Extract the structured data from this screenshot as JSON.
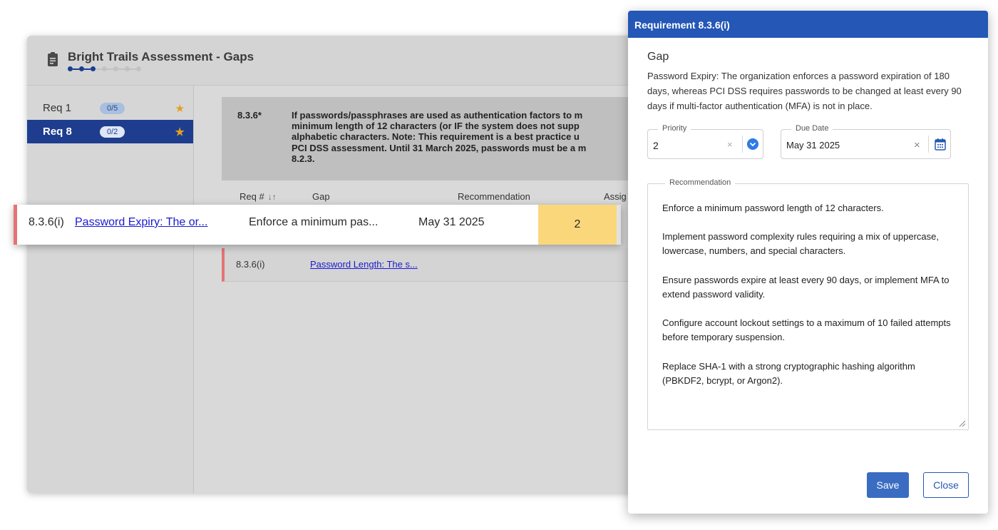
{
  "app": {
    "title": "Bright Trails Assessment - Gaps",
    "progress": {
      "completed_steps": 3,
      "total_steps": 7
    }
  },
  "sidebar": {
    "items": [
      {
        "label": "Req 1",
        "badge": "0/5",
        "active": false,
        "icon": "star-icon"
      },
      {
        "label": "Req 8",
        "badge": "0/2",
        "active": true,
        "icon": "star-icon"
      }
    ]
  },
  "requirement": {
    "code": "8.3.6*",
    "text": "If passwords/passphrases are used as authentication factors to m\nminimum length of 12 characters (or IF the system does not supp\nalphabetic characters.  Note: This requirement is a best practice u\nPCI DSS assessment. Until  31 March 2025, passwords must be a m\n8.2.3."
  },
  "table": {
    "headers": {
      "req": "Req #",
      "gap": "Gap",
      "recommendation": "Recommendation",
      "assignee": "Assig"
    },
    "sort_icon": "↓↑",
    "rows": [
      {
        "req": "8.3.6(i)",
        "gap": "Password Expiry: The or...",
        "recommendation": "Enforce a minimum pas...",
        "due": "May 31 2025",
        "priority": "2",
        "highlighted": true
      },
      {
        "req": "8.3.6(i)",
        "gap": "Password Length: The s...",
        "highlighted": false
      }
    ]
  },
  "dialog": {
    "title": "Requirement 8.3.6(i)",
    "gap_heading": "Gap",
    "gap_text": "Password Expiry: The organization enforces a password expiration of 180 days, whereas PCI DSS requires passwords to be changed at least every 90 days if multi-factor authentication (MFA) is not in place.",
    "priority": {
      "label": "Priority",
      "value": "2"
    },
    "due_date": {
      "label": "Due Date",
      "value": "May 31 2025"
    },
    "clear_glyph": "×",
    "recommendation": {
      "label": "Recommendation",
      "text": "Enforce a minimum password length of 12 characters.\n\nImplement password complexity rules requiring a mix of uppercase, lowercase, numbers, and special characters.\n\nEnsure passwords expire at least every 90 days, or implement MFA to extend password validity.\n\nConfigure account lockout settings to a maximum of 10 failed attempts before temporary suspension.\n\nReplace SHA-1 with a strong cryptographic hashing algorithm (PBKDF2, bcrypt, or Argon2)."
    },
    "save_label": "Save",
    "close_label": "Close"
  },
  "colors": {
    "primary": "#2457b6",
    "sidebar_active": "#1e3d8f",
    "priority_fill": "#fbd77b",
    "row_marker": "#e57373",
    "link": "#1a1ad0",
    "star": "#e0a01b"
  }
}
